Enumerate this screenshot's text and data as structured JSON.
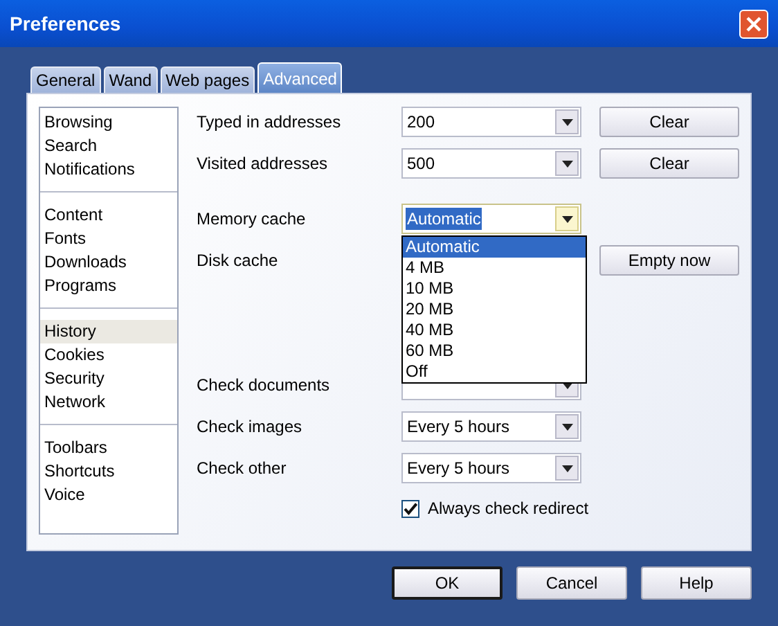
{
  "window": {
    "title": "Preferences"
  },
  "tabs": [
    {
      "label": "General",
      "selected": false
    },
    {
      "label": "Wand",
      "selected": false
    },
    {
      "label": "Web pages",
      "selected": false
    },
    {
      "label": "Advanced",
      "selected": true
    }
  ],
  "sidebar": {
    "groups": [
      [
        {
          "label": "Browsing",
          "selected": false
        },
        {
          "label": "Search",
          "selected": false
        },
        {
          "label": "Notifications",
          "selected": false
        }
      ],
      [
        {
          "label": "Content",
          "selected": false
        },
        {
          "label": "Fonts",
          "selected": false
        },
        {
          "label": "Downloads",
          "selected": false
        },
        {
          "label": "Programs",
          "selected": false
        }
      ],
      [
        {
          "label": "History",
          "selected": true
        },
        {
          "label": "Cookies",
          "selected": false
        },
        {
          "label": "Security",
          "selected": false
        },
        {
          "label": "Network",
          "selected": false
        }
      ],
      [
        {
          "label": "Toolbars",
          "selected": false
        },
        {
          "label": "Shortcuts",
          "selected": false
        },
        {
          "label": "Voice",
          "selected": false
        }
      ]
    ]
  },
  "address_rows": [
    {
      "label": "Typed in addresses",
      "kind": "combo",
      "value": "200",
      "button": "Clear"
    },
    {
      "label": "Visited addresses",
      "kind": "combo",
      "value": "500",
      "button": "Clear"
    }
  ],
  "cache_rows": [
    {
      "label": "Memory cache",
      "kind": "combo",
      "value": "Automatic",
      "focused": true,
      "expanded": true,
      "options": [
        {
          "label": "Automatic",
          "selected": true
        },
        {
          "label": "4 MB",
          "selected": false
        },
        {
          "label": "10 MB",
          "selected": false
        },
        {
          "label": "20 MB",
          "selected": false
        },
        {
          "label": "40 MB",
          "selected": false
        },
        {
          "label": "60 MB",
          "selected": false
        },
        {
          "label": "Off",
          "selected": false
        }
      ]
    },
    {
      "label": "Disk cache",
      "kind": "plain",
      "button": "Empty now"
    }
  ],
  "check_rows": [
    {
      "label": "Check documents",
      "kind": "combo"
    },
    {
      "label": "Check images",
      "kind": "combo",
      "value": "Every 5 hours"
    },
    {
      "label": "Check other",
      "kind": "combo",
      "value": "Every 5 hours"
    }
  ],
  "redirect": {
    "label": "Always check redirect",
    "checked": true
  },
  "buttons": [
    {
      "label": "OK",
      "default": true
    },
    {
      "label": "Cancel",
      "default": false
    },
    {
      "label": "Help",
      "default": false
    }
  ]
}
